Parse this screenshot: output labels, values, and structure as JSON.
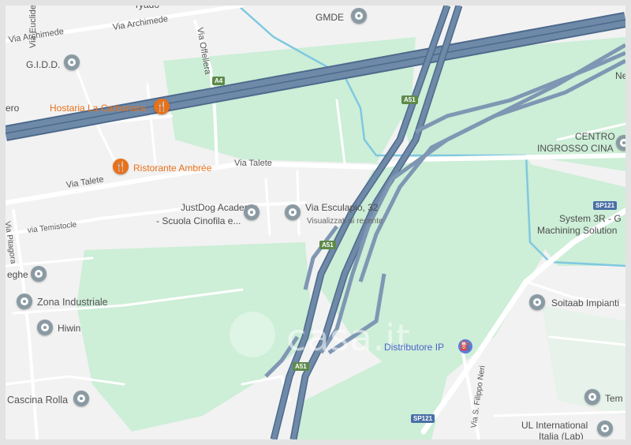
{
  "labels": {
    "via_euclide": "Via Euclide",
    "via_archimede_1": "Via Archimede",
    "via_archimede_2": "Via Archimede",
    "via_offellera": "Via Offellera",
    "gmde": "GMDE",
    "gidd": "G.I.D.D.",
    "hostaria": "Hostaria La Carbonara",
    "ero": "ero",
    "ristorante": "Ristorante Ambrée",
    "via_talete_1": "Via Talete",
    "via_talete_2": "Via Talete",
    "via_temistocle": "via Temistocle",
    "via_pitagora": "Via Pitagora",
    "justdog_1": "JustDog Academy",
    "justdog_2": "- Scuola Cinofila e...",
    "via_esculapio": "Via Esculapio, 32",
    "visualizzati": "Visualizzati di recente",
    "centro_1": "CENTRO",
    "centro_2": "INGROSSO CINA",
    "system_1": "System 3R - G",
    "system_2": "Machining Solution",
    "eghe": "eghe",
    "zona_industriale": "Zona Industriale",
    "hiwin": "Hiwin",
    "soitaab": "Soitaab Impianti",
    "distributore": "Distributore IP",
    "cascina_rolla": "Cascina Rolla",
    "via_s_filippo_neri": "Via S. Filippo Neri",
    "ul_1": "UL International",
    "ul_2": "Italia (Lab)",
    "tem": "Tem",
    "ne": "Ne",
    "rodo": "ryado"
  },
  "shields": {
    "a4": "A4",
    "a51_1": "A51",
    "a51_2": "A51",
    "a51_3": "A51",
    "sp121_1": "SP121",
    "sp121_2": "SP121"
  },
  "watermark": "casa.it",
  "colors": {
    "park": "#cdeed7",
    "highway": "#6f8aa8",
    "highway_dark": "#4d6a8c",
    "water": "#7fc8e0",
    "road": "#ffffff",
    "poi_orange": "#e8711a",
    "poi_gray": "#8a9aa3"
  }
}
